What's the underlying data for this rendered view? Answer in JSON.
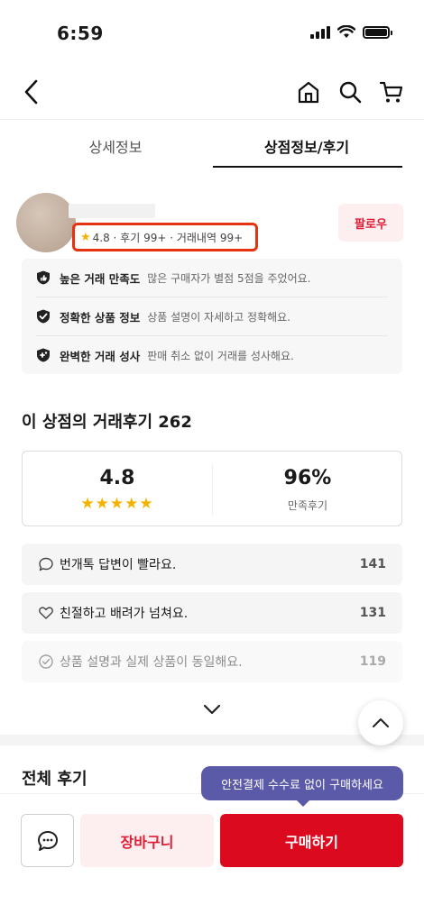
{
  "status_bar": {
    "time": "6:59"
  },
  "tabs": [
    {
      "label": "상세정보"
    },
    {
      "label": "상점정보/후기"
    }
  ],
  "store": {
    "rating": "4.8",
    "stats_text": "4.8 · 후기 99+ · 거래내역 99+",
    "follow_label": "팔로우"
  },
  "badges": [
    {
      "title": "높은 거래 만족도",
      "desc": "많은 구매자가 별점 5점을 주었어요.",
      "icon": "thumbs-up-shield-icon"
    },
    {
      "title": "정확한 상품 정보",
      "desc": "상품 설명이 자세하고 정확해요.",
      "icon": "check-shield-icon"
    },
    {
      "title": "완벽한 거래 성사",
      "desc": "판매 취소 없이 거래를 성사해요.",
      "icon": "plus-shield-icon"
    }
  ],
  "reviews_section": {
    "title": "이 상점의 거래후기 262",
    "score": "4.8",
    "stars": 5,
    "satisfaction": "96%",
    "satisfaction_label": "만족후기"
  },
  "review_items": [
    {
      "text": "번개톡 답변이 빨라요.",
      "count": "141",
      "icon": "speech-bubble-icon"
    },
    {
      "text": "친절하고 배려가 넘쳐요.",
      "count": "131",
      "icon": "heart-icon"
    },
    {
      "text": "상품 설명과 실제 상품이 동일해요.",
      "count": "119",
      "icon": "check-circle-icon"
    }
  ],
  "all_reviews_title": "전체 후기",
  "bottom": {
    "tooltip": "안전결제 수수료 없이 구매하세요",
    "cart_label": "장바구니",
    "buy_label": "구매하기"
  },
  "colors": {
    "accent_red": "#db0a1e",
    "highlight_box": "#e53312",
    "star": "#f5b301",
    "tooltip_bg": "#5a5aa8"
  }
}
